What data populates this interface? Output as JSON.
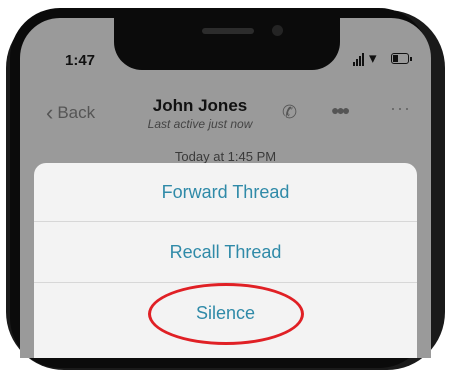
{
  "status_bar": {
    "time": "1:47"
  },
  "nav": {
    "back_label": "Back",
    "contact_name": "John Jones",
    "contact_status": "Last active just now",
    "icons": [
      "chevron-left-icon",
      "phone-icon",
      "group-icon",
      "more-icon"
    ]
  },
  "conversation": {
    "timestamp": "Today at 1:45 PM"
  },
  "action_sheet": {
    "items": [
      {
        "label": "Forward Thread"
      },
      {
        "label": "Recall Thread"
      },
      {
        "label": "Silence"
      }
    ],
    "highlight_color": "#e02025",
    "action_color": "#2f8aa8"
  }
}
